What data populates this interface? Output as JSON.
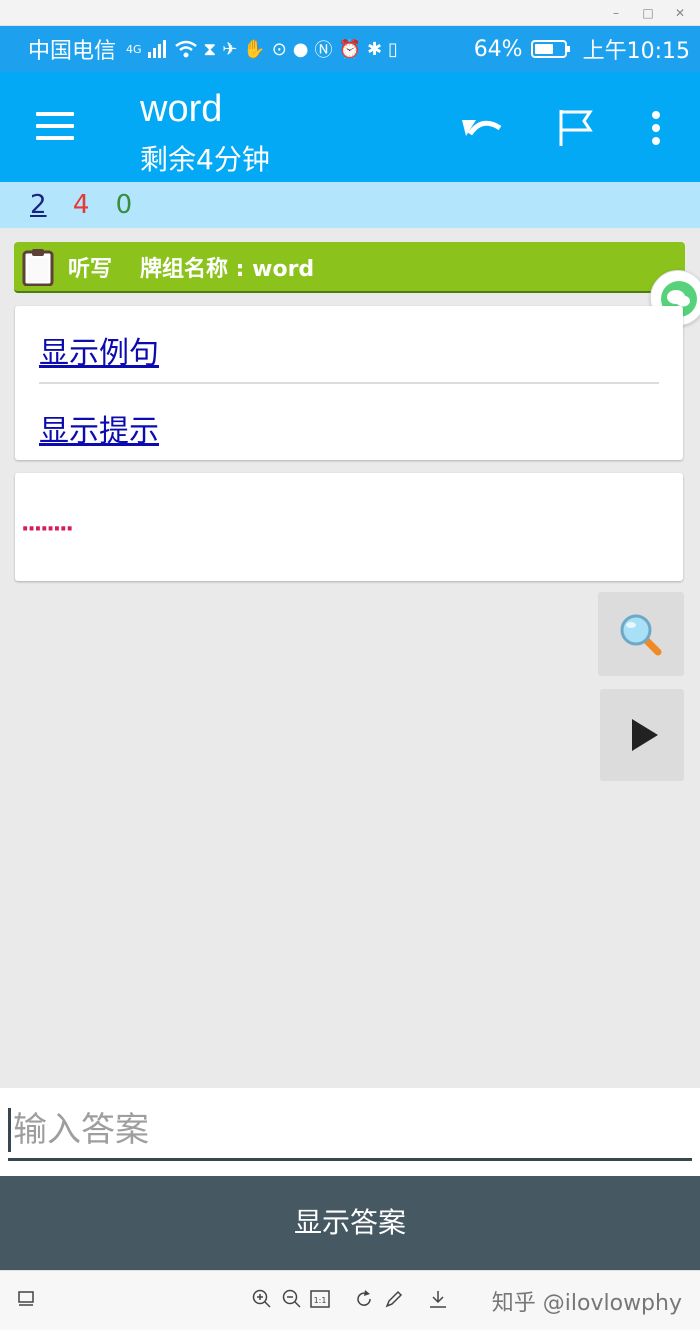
{
  "window": {
    "minimize_glyph": "–",
    "maximize_glyph": "□",
    "close_glyph": "✕"
  },
  "statusbar": {
    "carrier": "中国电信",
    "network": "4G",
    "battery_text": "64%",
    "battery_level": 0.64,
    "time": "上午10:15"
  },
  "appbar": {
    "title": "word",
    "subtitle": "剩余4分钟"
  },
  "progress": {
    "blue": "2",
    "red": "4",
    "green": "0"
  },
  "deck": {
    "mode": "听写",
    "name_label": "牌组名称 : word"
  },
  "links": {
    "show_example": "显示例句",
    "show_hint": "显示提示"
  },
  "answer_card": {
    "dots": "········"
  },
  "input": {
    "placeholder": "输入答案"
  },
  "show_answer_label": "显示答案",
  "watermark": "知乎 @ilovlowphy",
  "colors": {
    "statusbar": "#1da1ee",
    "appbar": "#03a9f4",
    "progress_strip": "#b3e5fc",
    "deck_bar": "#8bc21c",
    "show_answer_bg": "#465963"
  }
}
